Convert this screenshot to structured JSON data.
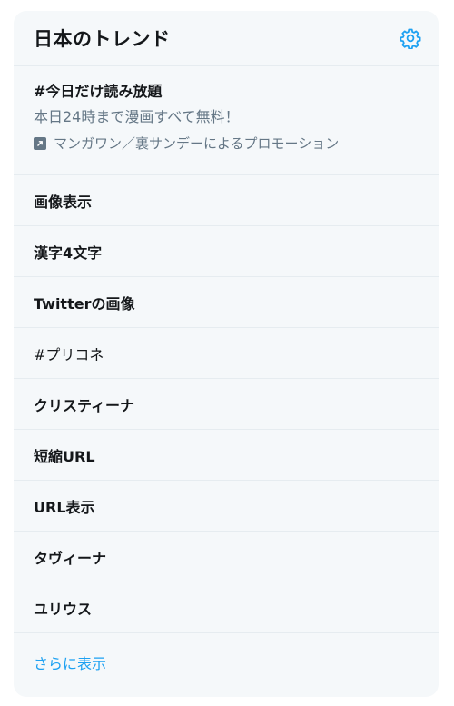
{
  "header": {
    "title": "日本のトレンド",
    "settings_icon": "gear-icon",
    "accent_color": "#1da1f2"
  },
  "promoted": {
    "hashtag": "#今日だけ読み放題",
    "description": "本日24時まで漫画すべて無料！",
    "promoted_by": "マンガワン／裏サンデーによるプロモーション",
    "icon": "promoted-icon"
  },
  "trends": [
    {
      "label": "画像表示"
    },
    {
      "label": "漢字4文字"
    },
    {
      "label": "Twitterの画像"
    },
    {
      "label": "#プリコネ"
    },
    {
      "label": "クリスティーナ"
    },
    {
      "label": "短縮URL"
    },
    {
      "label": "URL表示"
    },
    {
      "label": "タヴィーナ"
    },
    {
      "label": "ユリウス"
    }
  ],
  "footer": {
    "show_more": "さらに表示"
  }
}
